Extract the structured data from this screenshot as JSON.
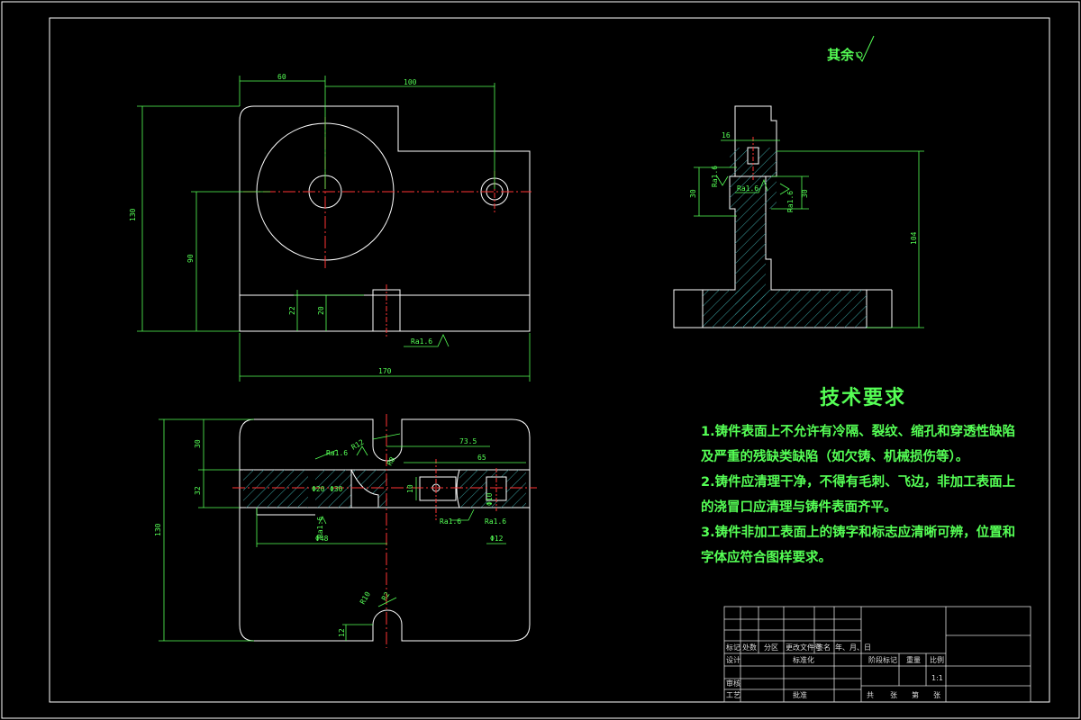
{
  "surface_finish_note": "其余",
  "technical_requirements": {
    "title": "技术要求",
    "items": [
      "1.铸件表面上不允许有冷隔、裂纹、缩孔和穿透性缺陷及严重的残缺类缺陷（如欠铸、机械损伤等）。",
      "2.铸件应清理干净，不得有毛刺、飞边，非加工表面上的浇冒口应清理与铸件表面齐平。",
      "3.铸件非加工表面上的铸字和标志应清晰可辨，位置和字体应符合图样要求。"
    ]
  },
  "dimensions": {
    "front_top_left": "60",
    "front_top_right": "100",
    "front_height_total": "130",
    "front_height_center": "90",
    "front_small_left": "22",
    "front_small_right": "20",
    "front_width_total": "170",
    "front_roughness": "Ra1.6",
    "side_top": "16",
    "side_ra_left": "Ra1.6",
    "side_ra_mid": "Ra1.6",
    "side_ra_right": "Ra1.6",
    "side_left_dim": "30",
    "side_right_dim": "30",
    "side_height": "104",
    "top_view_top": "30",
    "top_view_left_mid": "32",
    "top_view_height": "130",
    "top_view_bottom": "12",
    "top_view_r12": "R12",
    "top_view_r8": "R8",
    "top_view_radius_big": "R10",
    "top_view_dim_r": "73.5",
    "top_view_dim_65": "65",
    "top_view_dim_10": "10",
    "top_view_ra1": "Ra1.6",
    "top_view_ra2": "Ra1.6",
    "top_view_ra3": "Ra1.6",
    "top_view_ra4": "Ra1.6",
    "top_view_phi20": "Φ20",
    "top_view_phi48": "Φ48",
    "top_view_phi10": "Φ10",
    "top_view_phi12": "Φ12",
    "top_view_phi30": "Φ30",
    "top_view_r2": "R2"
  },
  "title_block": {
    "row_labels": [
      "标记",
      "处数",
      "分区",
      "更改文件号",
      "签名",
      "年、月、日"
    ],
    "design": "设计",
    "standardize": "标准化",
    "stage_mark": "阶段标记",
    "weight": "重量",
    "scale": "比例",
    "scale_value": "1:1",
    "review": "审核",
    "process": "工艺",
    "approve": "批准",
    "sheet_total": "共",
    "sheet_label": "张",
    "sheet_no": "第",
    "sheet_label2": "张"
  }
}
